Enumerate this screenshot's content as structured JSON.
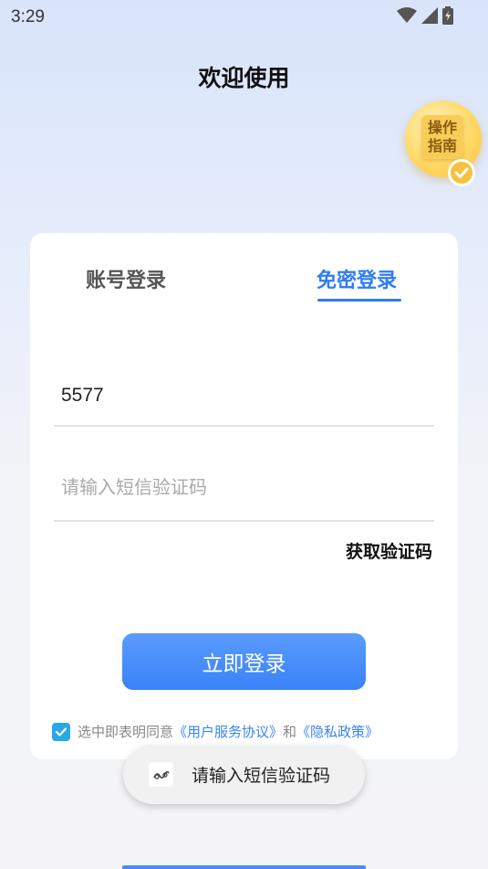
{
  "status": {
    "time": "3:29"
  },
  "header": {
    "title": "欢迎使用"
  },
  "guide": {
    "line1": "操作",
    "line2": "指南"
  },
  "tabs": [
    {
      "label": "账号登录",
      "active": false
    },
    {
      "label": "免密登录",
      "active": true
    }
  ],
  "form": {
    "phone_value": "5577",
    "code_placeholder": "请输入短信验证码",
    "get_code_label": "获取验证码",
    "submit_label": "立即登录"
  },
  "agreement": {
    "checked": true,
    "prefix": "选中即表明同意",
    "user_agreement": "《用户服务协议》",
    "conjunction": "和",
    "privacy_policy": "《隐私政策》"
  },
  "toast": {
    "message": "请输入短信验证码"
  },
  "colors": {
    "accent": "#2f7cf6",
    "button": "#3a82f7",
    "checkbox": "#29a8e8",
    "badge": "#f7c13d"
  }
}
